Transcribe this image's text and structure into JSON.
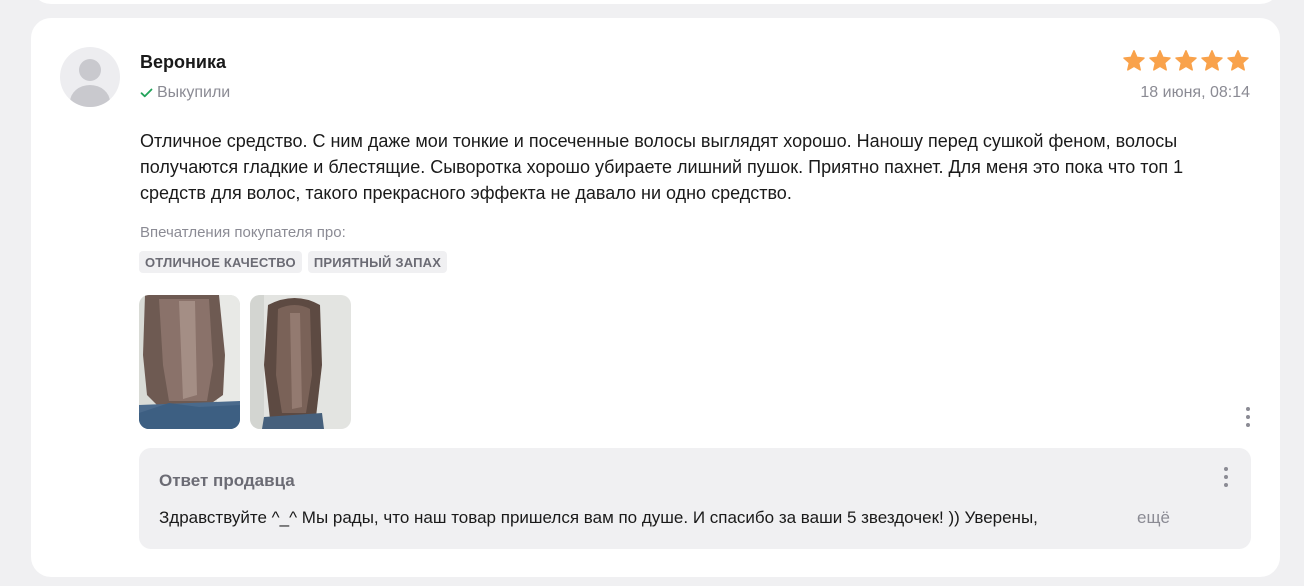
{
  "review": {
    "author": "Вероника",
    "bought_label": "Выкупили",
    "rating": 5,
    "rating_max": 5,
    "date": "18 июня, 08:14",
    "text": "Отличное средство. С ним даже мои тонкие и посеченные волосы выглядят хорошо. Наношу перед сушкой феном, волосы получаются гладкие и блестящие. Сыворотка хорошо убираете лишний пушок. Приятно пахнет. Для меня это пока что топ 1 средств для волос, такого прекрасного эффекта не давало ни одно средство.",
    "impressions_label": "Впечатления покупателя про:",
    "tags": [
      "отличное качество",
      "приятный запах"
    ],
    "photo_count": 2
  },
  "seller_reply": {
    "title": "Ответ продавца",
    "text": "Здравствуйте ^_^ Мы рады, что наш товар пришелся вам по душе. И спасибо за ваши 5 звездочек! )) Уверены, ",
    "more_label": "ещё"
  },
  "colors": {
    "star": "#f9a24b",
    "check": "#22a35a",
    "muted_text": "#8b8b94",
    "background": "#f0f0f2"
  },
  "icons": {
    "check": "check-icon",
    "star": "star-icon",
    "more": "more-vertical-icon",
    "avatar": "user-placeholder-icon"
  }
}
